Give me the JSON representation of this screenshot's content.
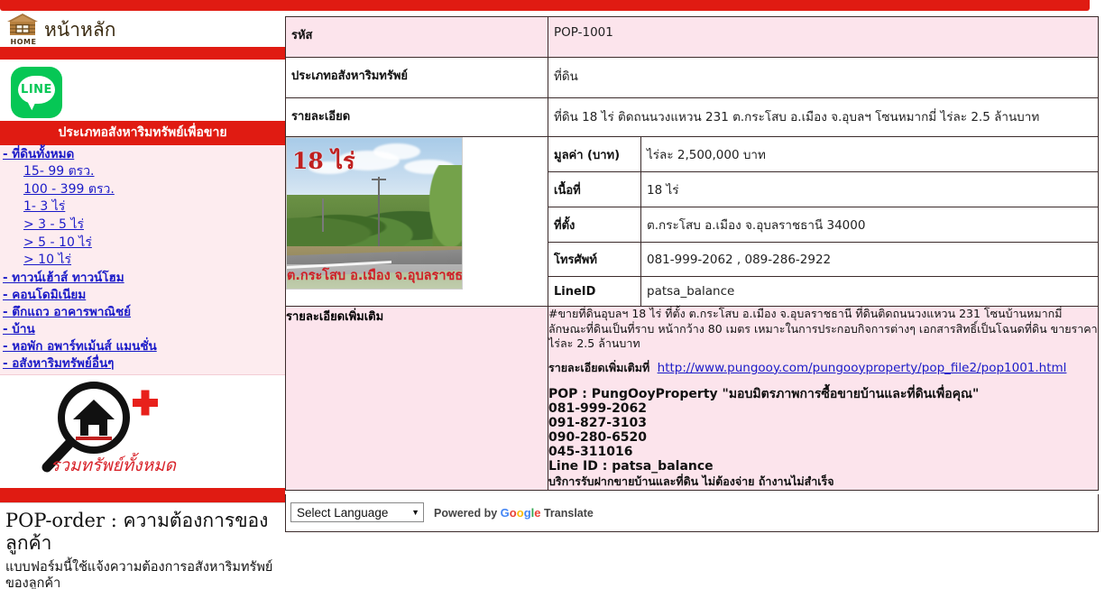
{
  "sidebar": {
    "home": {
      "label": "หน้าหลัก",
      "icon": "home-cabin-icon",
      "icon_caption": "HOME"
    },
    "line_logo": {
      "text": "LINE",
      "color": "#06c755"
    },
    "category_header": "ประเภทอสังหาริมทรัพย์เพื่อขาย",
    "nav_items": [
      {
        "label": "- ที่ดินทั้งหมด",
        "level": "top"
      },
      {
        "label": "15- 99 ตรว.",
        "level": "sub"
      },
      {
        "label": "100 - 399 ตรว.",
        "level": "sub"
      },
      {
        "label": "1- 3 ไร่",
        "level": "sub"
      },
      {
        "label": "> 3 - 5 ไร่",
        "level": "sub"
      },
      {
        "label": "> 5 - 10 ไร่",
        "level": "sub"
      },
      {
        "label": "> 10 ไร่",
        "level": "sub"
      },
      {
        "label": "- ทาวน์เฮ้าส์ ทาวน์โฮม",
        "level": "top"
      },
      {
        "label": "- คอนโดมิเนียม",
        "level": "top"
      },
      {
        "label": "- ตึกแถว อาคารพาณิชย์",
        "level": "top"
      },
      {
        "label": "- บ้าน",
        "level": "top"
      },
      {
        "label": "- หอพัก อพาร์ทเม้นส์ แมนชั่น",
        "level": "top"
      },
      {
        "label": "- อสังหาริมทรัพย์อื่นๆ",
        "level": "top"
      }
    ],
    "search_all": {
      "icon": "magnifier-house-plus-icon",
      "caption": "รวมทรัพย์ทั้งหมด"
    },
    "pop_order": {
      "title": "POP-order : ความต้องการของลูกค้า",
      "description": "แบบฟอร์มนี้ใช้แจ้งความต้องการอสังหาริมทรัพย์ของลูกค้า"
    }
  },
  "property": {
    "rows": [
      {
        "label": "รหัส",
        "value": "POP-1001"
      },
      {
        "label": "ประเภทอสังหาริมทรัพย์",
        "value": "ที่ดิน"
      },
      {
        "label": "รายละเอียด",
        "value": "ที่ดิน 18 ไร่ ติดถนนวงแหวน 231 ต.กระโสบ อ.เมือง จ.อุบลฯ โซนหมากมี่ ไร่ละ 2.5 ล้านบาท"
      }
    ],
    "photo": {
      "overlay_top": "18 ไร่",
      "overlay_bottom": "ต.กระโสบ อ.เมือง จ.อุบลราชธานี",
      "alt": "ที่ดินติดถนนวงแหวน"
    },
    "specs": [
      {
        "label": "มูลค่า (บาท)",
        "value": "ไร่ละ 2,500,000 บาท"
      },
      {
        "label": "เนื้อที่",
        "value": "18 ไร่"
      },
      {
        "label": "ที่ตั้ง",
        "value": "ต.กระโสบ อ.เมือง จ.อุบลราชธานี 34000"
      },
      {
        "label": "โทรศัพท์",
        "value": "081-999-2062 , 089-286-2922"
      },
      {
        "label": "LineID",
        "value": "patsa_balance"
      }
    ],
    "extra": {
      "label": "รายละเอียดเพิ่มเติม",
      "paragraph": "#ขายที่ดินอุบลฯ 18 ไร่ ที่ตั้ง ต.กระโสบ อ.เมือง จ.อุบลราชธานี ที่ดินติดถนนวงแหวน 231 โซนบ้านหมากมี่ ลักษณะที่ดินเป็นที่ราบ หน้ากว้าง 80 เมตร เหมาะในการประกอบกิจการต่างๆ เอกสารสิทธิ์เป็นโฉนดที่ดิน ขายราคาไร่ละ 2.5 ล้านบาท",
      "link_label": "รายละเอียดเพิ่มเติมที่",
      "link_text": "http://www.pungooy.com/pungooyproperty/pop_file2/pop1001.html",
      "slogan": "POP : PungOoyProperty \"มอบมิตรภาพการซื้อขายบ้านและที่ดินเพื่อคุณ\"",
      "phones": [
        "081-999-2062",
        "091-827-3103",
        "090-280-6520",
        "045-311016"
      ],
      "line_id_line": "Line ID : patsa_balance",
      "tail": "บริการรับฝากขายบ้านและที่ดิน ไม่ต้องจ่าย ถ้างานไม่สำเร็จ"
    }
  },
  "translate": {
    "select_value": "Select Language",
    "powered_by": "Powered by",
    "google": "Google",
    "translate_word": "Translate"
  },
  "colors": {
    "brand_red": "#e01b12",
    "row_pink": "#fce4ec",
    "nav_pink": "#fdecef",
    "link_blue": "#1a1ac8",
    "line_green": "#06c755"
  }
}
